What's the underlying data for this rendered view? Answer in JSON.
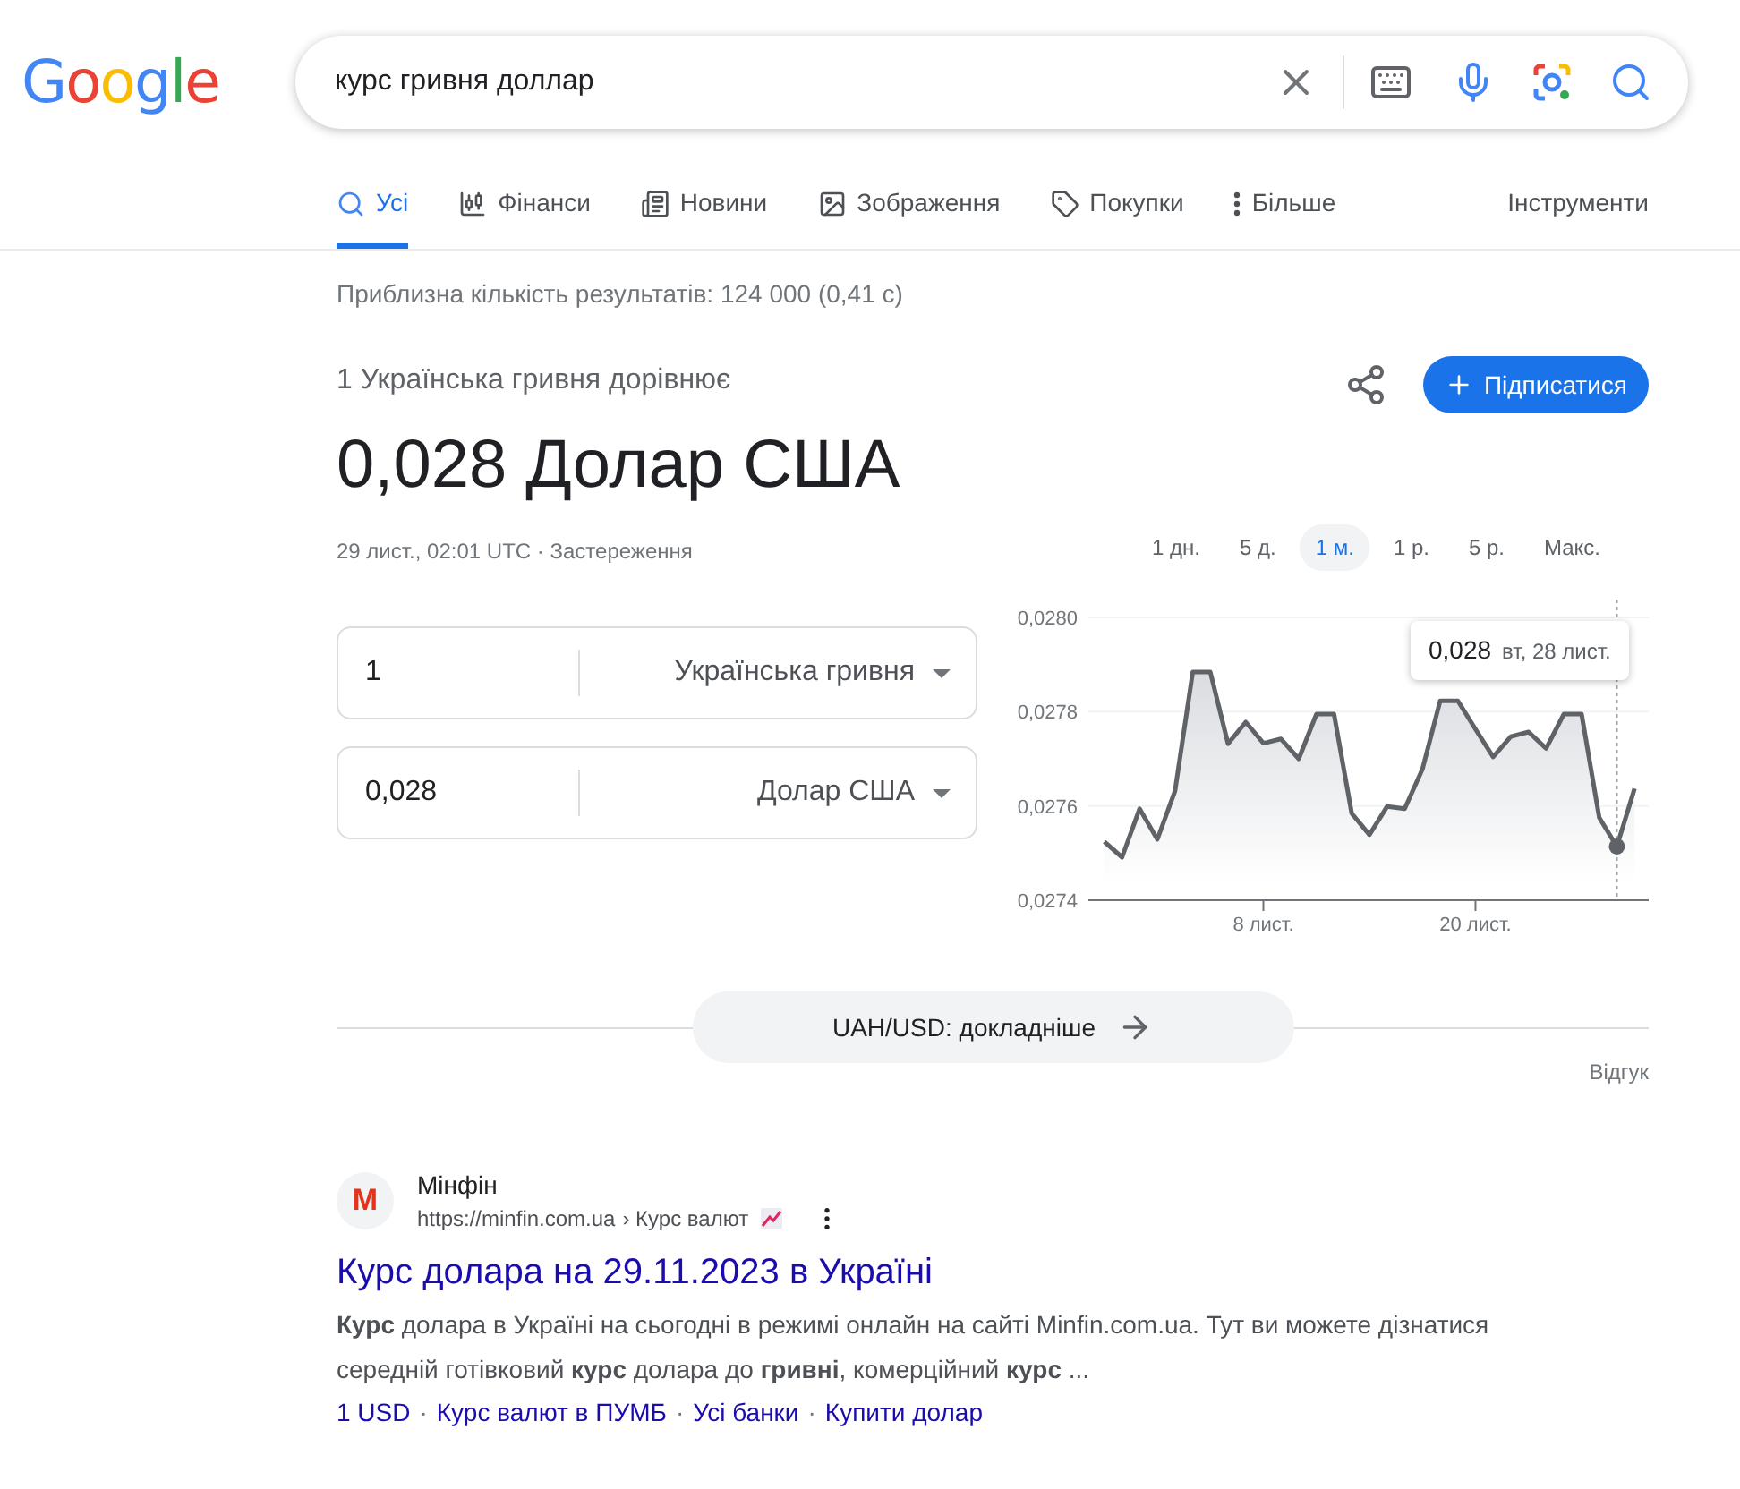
{
  "logo": "Google",
  "search": {
    "value": "курс гривня доллар"
  },
  "tabs": [
    {
      "label": "Усі",
      "kind": "all",
      "selected": true
    },
    {
      "label": "Фінанси",
      "kind": "finance",
      "selected": false
    },
    {
      "label": "Новини",
      "kind": "news",
      "selected": false
    },
    {
      "label": "Зображення",
      "kind": "images",
      "selected": false
    },
    {
      "label": "Покупки",
      "kind": "shopping",
      "selected": false
    },
    {
      "label": "Більше",
      "kind": "more",
      "selected": false
    }
  ],
  "tools": "Інструменти",
  "results_stats": "Приблизна кількість результатів: 124 000 (0,41 с)",
  "converter": {
    "headline": "1 Українська гривня дорівнює",
    "result": "0,028 Долар США",
    "timestamp": "29 лист., 02:01 UTC · Застереження",
    "follow_button": "Підписатися",
    "rows": [
      {
        "amount": "1",
        "currency": "Українська гривня"
      },
      {
        "amount": "0,028",
        "currency": "Долар США"
      }
    ],
    "ranges": [
      {
        "label": "1 дн.",
        "selected": false
      },
      {
        "label": "5 д.",
        "selected": false
      },
      {
        "label": "1 м.",
        "selected": true
      },
      {
        "label": "1 р.",
        "selected": false
      },
      {
        "label": "5 р.",
        "selected": false
      },
      {
        "label": "Макс.",
        "selected": false
      }
    ],
    "chart_data": {
      "type": "area",
      "x": [
        -1,
        0,
        1,
        2,
        3,
        4,
        5,
        6,
        7,
        8,
        9,
        10,
        11,
        12,
        13,
        14,
        15,
        16,
        17,
        18,
        19,
        20,
        21,
        22,
        23,
        24,
        25,
        26,
        27,
        28,
        29
      ],
      "series": [
        {
          "color": "#5f6368",
          "values": [
            0.027524,
            0.027491,
            0.027594,
            0.027529,
            0.027632,
            0.027884,
            0.027884,
            0.027732,
            0.027778,
            0.027733,
            0.027742,
            0.0277,
            0.027795,
            0.027795,
            0.027584,
            0.027539,
            0.027599,
            0.027594,
            0.027678,
            0.027823,
            0.027823,
            0.027763,
            0.027704,
            0.027747,
            0.027757,
            0.027722,
            0.027795,
            0.027795,
            0.027575,
            0.027514,
            0.027637
          ]
        }
      ],
      "ylim": [
        0.0274,
        0.028
      ],
      "yticks": [
        {
          "value": 0.0274,
          "label": "0,0274"
        },
        {
          "value": 0.0276,
          "label": "0,0276"
        },
        {
          "value": 0.0278,
          "label": "0,0278"
        },
        {
          "value": 0.028,
          "label": "0,0280"
        }
      ],
      "xticks": [
        {
          "value": 8,
          "label": "8 лист."
        },
        {
          "value": 20,
          "label": "20 лист."
        }
      ],
      "xlim": [
        -1.9,
        29.8
      ],
      "ref_lines": [
        {
          "axis": "x",
          "value": 28
        }
      ]
    },
    "tooltip": {
      "value": "0,028",
      "date": "вт, 28 лист."
    },
    "more_button": "UAH/USD: докладніше",
    "feedback": "Відгук"
  },
  "results": [
    {
      "favicon": "M",
      "site": "Мінфін",
      "url": "https://minfin.com.ua",
      "breadcrumb": "› Курс валют",
      "title": "Курс долара на 29.11.2023 в Україні",
      "snippet": "**Курс** долара в Україні на сьогодні в режимі онлайн на сайті Minfin.com.ua. Тут ви можете дізнатися середній готівковий **курс** долара до **гривні**, комерційний **курс** ...",
      "separator": "·",
      "links": [
        "1 USD",
        "Курс валют в ПУМБ",
        "Усі банки",
        "Купити долар"
      ]
    }
  ]
}
